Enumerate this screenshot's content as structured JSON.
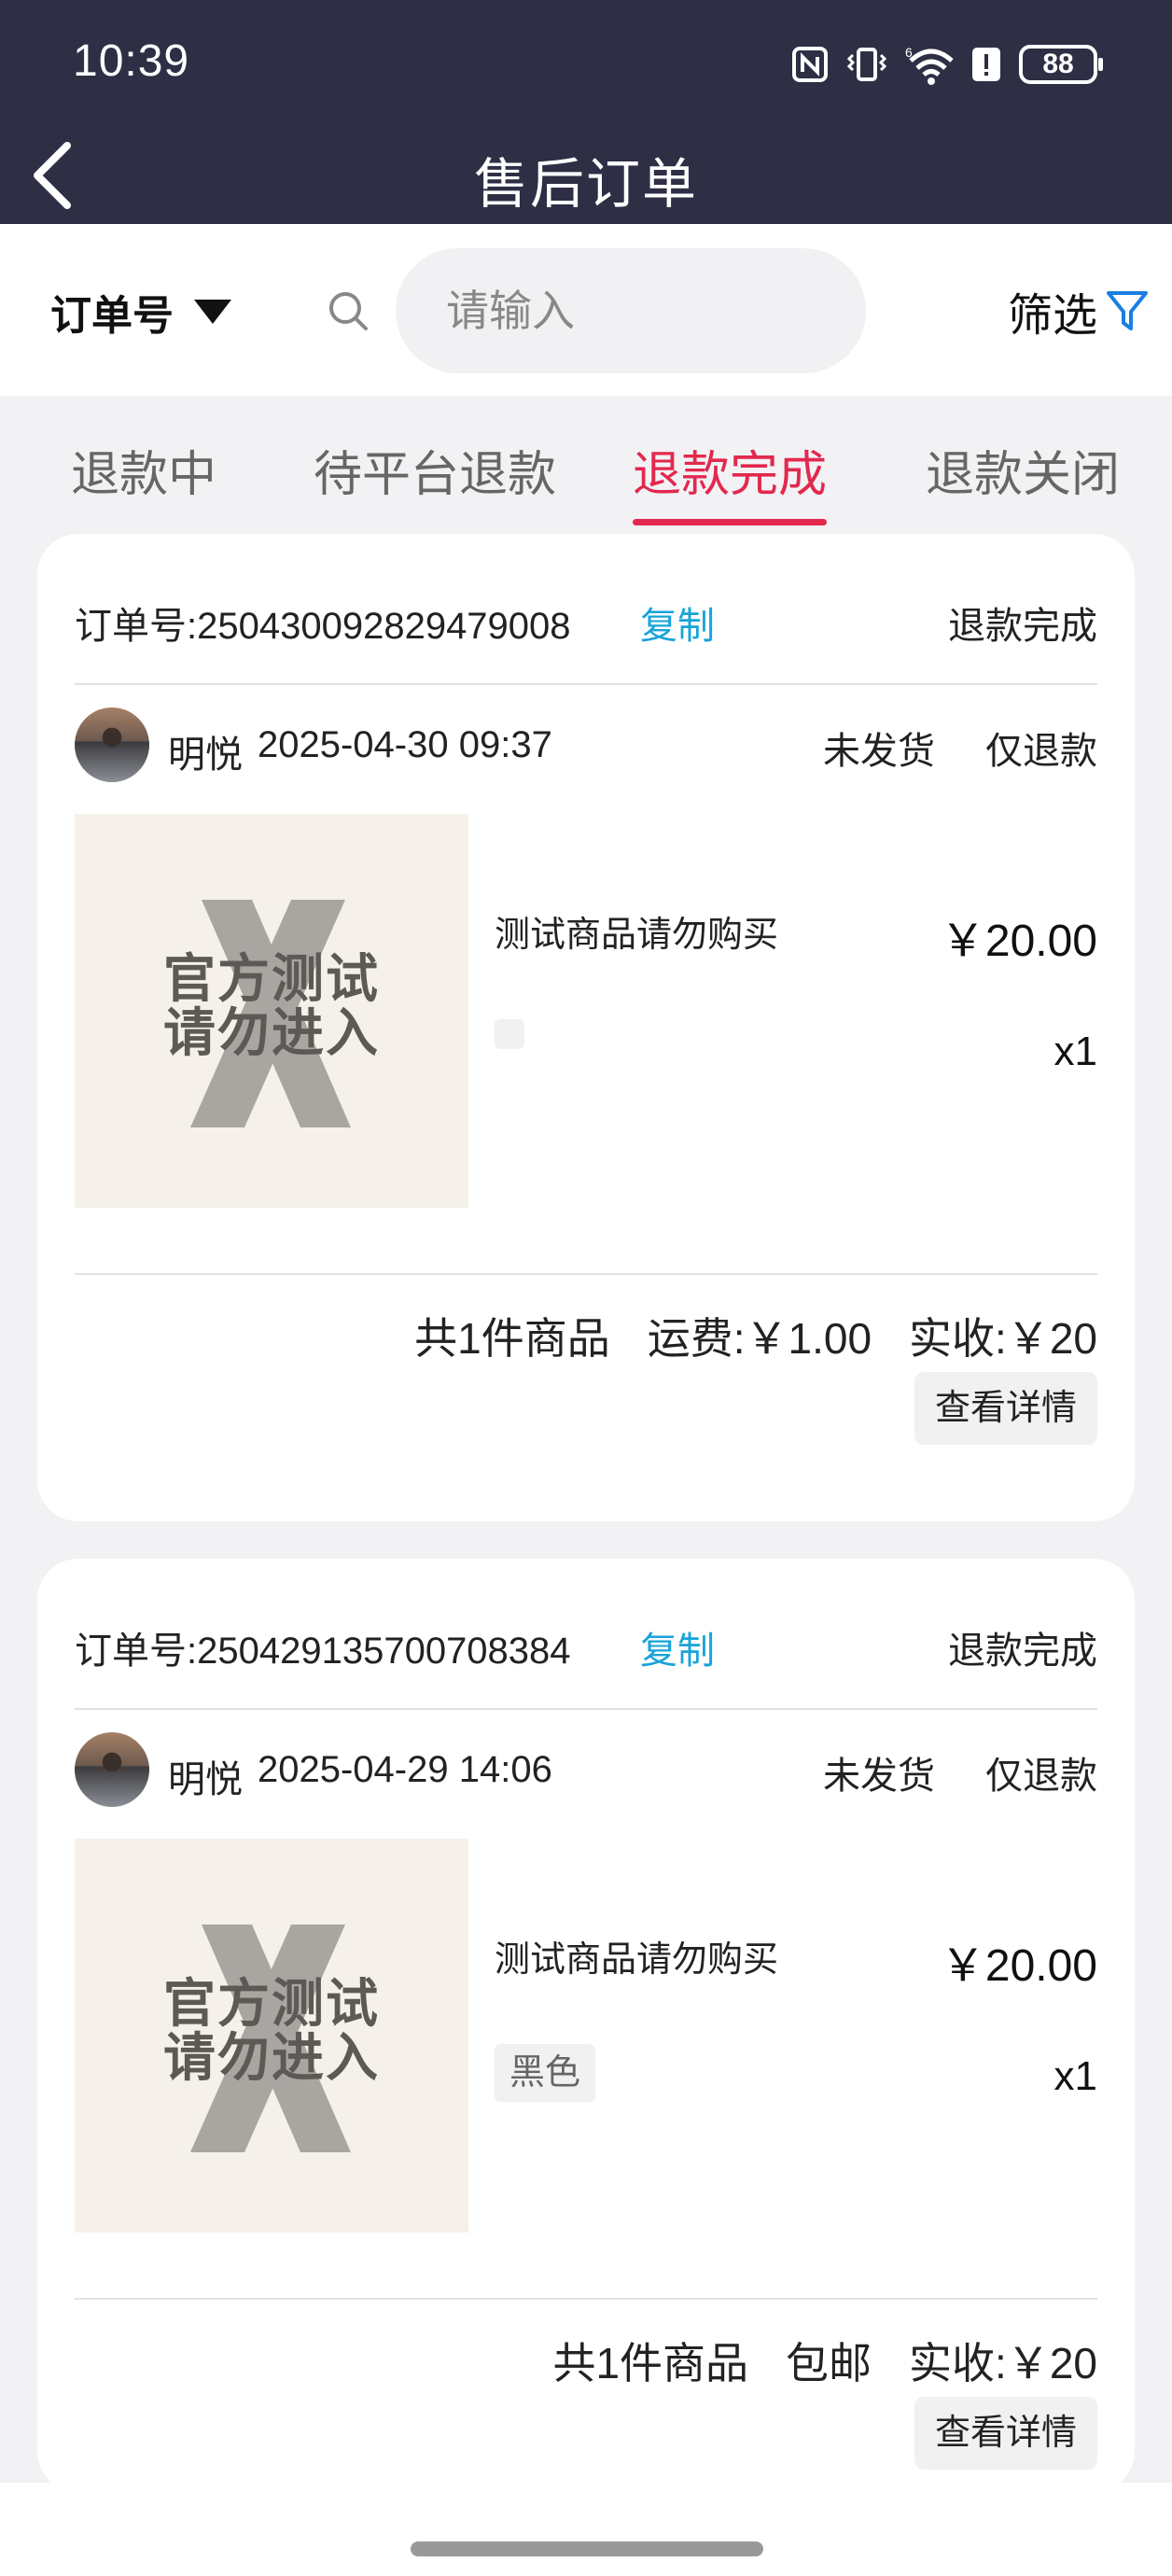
{
  "status_bar": {
    "time": "10:39",
    "battery": "88"
  },
  "header": {
    "title": "售后订单"
  },
  "search": {
    "field_label": "订单号",
    "placeholder": "请输入",
    "filter_label": "筛选"
  },
  "tabs": [
    {
      "label": "退款中",
      "active": false
    },
    {
      "label": "待平台退款",
      "active": false
    },
    {
      "label": "退款完成",
      "active": true
    },
    {
      "label": "退款关闭",
      "active": false
    }
  ],
  "orders": [
    {
      "order_no": "订单号:250430092829479008",
      "copy_label": "复制",
      "status": "退款完成",
      "user_name": "明悦",
      "time": "2025-04-30 09:37",
      "ship_status": "未发货",
      "refund_type": "仅退款",
      "product_title": "测试商品请勿购买",
      "watermark_line1": "官方测试",
      "watermark_line2": "请勿进入",
      "price": "￥20.00",
      "sku": "",
      "qty": "x1",
      "item_count": "共1件商品",
      "shipping": "运费:￥1.00",
      "received": "实收:￥20",
      "detail_label": "查看详情"
    },
    {
      "order_no": "订单号:250429135700708384",
      "copy_label": "复制",
      "status": "退款完成",
      "user_name": "明悦",
      "time": "2025-04-29 14:06",
      "ship_status": "未发货",
      "refund_type": "仅退款",
      "product_title": "测试商品请勿购买",
      "watermark_line1": "官方测试",
      "watermark_line2": "请勿进入",
      "price": "￥20.00",
      "sku": "黑色",
      "qty": "x1",
      "item_count": "共1件商品",
      "shipping": "包邮",
      "received": "实收:￥20",
      "detail_label": "查看详情"
    }
  ],
  "colors": {
    "header_bg": "#2e2f45",
    "accent": "#e2284e",
    "link": "#17a4d8",
    "filter_icon": "#1a7fe0"
  },
  "icons": [
    "nfc-icon",
    "vibrate-icon",
    "wifi-icon",
    "alert-icon",
    "battery-icon",
    "back-icon",
    "search-icon",
    "filter-icon"
  ]
}
